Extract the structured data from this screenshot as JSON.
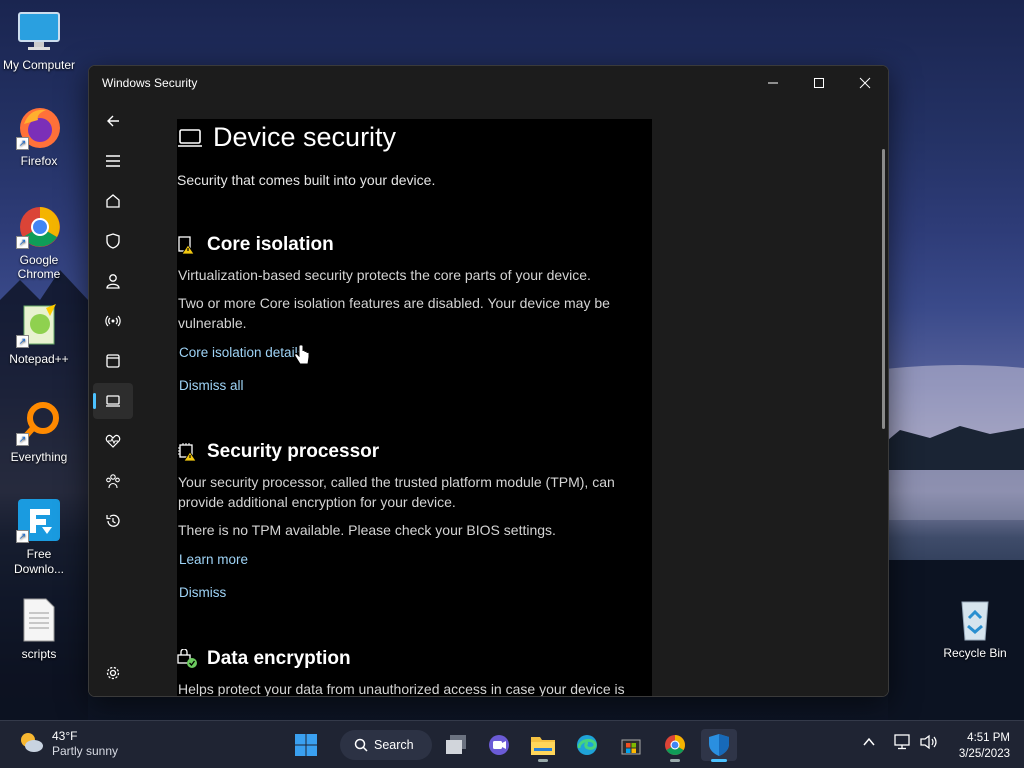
{
  "desktop": {
    "icons": [
      {
        "label": "My Computer"
      },
      {
        "label": "Firefox"
      },
      {
        "label": "Google Chrome"
      },
      {
        "label": "Notepad++"
      },
      {
        "label": "Everything"
      },
      {
        "label": "Free Downlo..."
      },
      {
        "label": "scripts"
      },
      {
        "label": "Recycle Bin"
      }
    ]
  },
  "window": {
    "title": "Windows Security",
    "page_title": "Device security",
    "page_subtitle": "Security that comes built into your device.",
    "sections": [
      {
        "heading": "Core isolation",
        "icon": "core-isolation-warning-icon",
        "paragraphs": [
          "Virtualization-based security protects the core parts of your device.",
          "Two or more Core isolation features are disabled.  Your device may be vulnerable."
        ],
        "links": [
          "Core isolation details",
          "Dismiss all"
        ]
      },
      {
        "heading": "Security processor",
        "icon": "chip-warning-icon",
        "paragraphs": [
          "Your security processor, called the trusted platform module (TPM), can provide additional encryption for your device.",
          "There is no TPM available. Please check your BIOS settings."
        ],
        "links": [
          "Learn more",
          "Dismiss"
        ]
      },
      {
        "heading": "Data encryption",
        "icon": "data-encryption-check-icon",
        "paragraphs": [
          "Helps protect your data from unauthorized access in case your device is"
        ]
      }
    ]
  },
  "taskbar": {
    "search_label": "Search",
    "weather_temp": "43°F",
    "weather_desc": "Partly sunny",
    "time": "4:51 PM",
    "date": "3/25/2023"
  },
  "colors": {
    "accent": "#4cc2ff",
    "link": "#9fd4f7",
    "warning": "#f2c811",
    "ok": "#6ccb5f"
  }
}
